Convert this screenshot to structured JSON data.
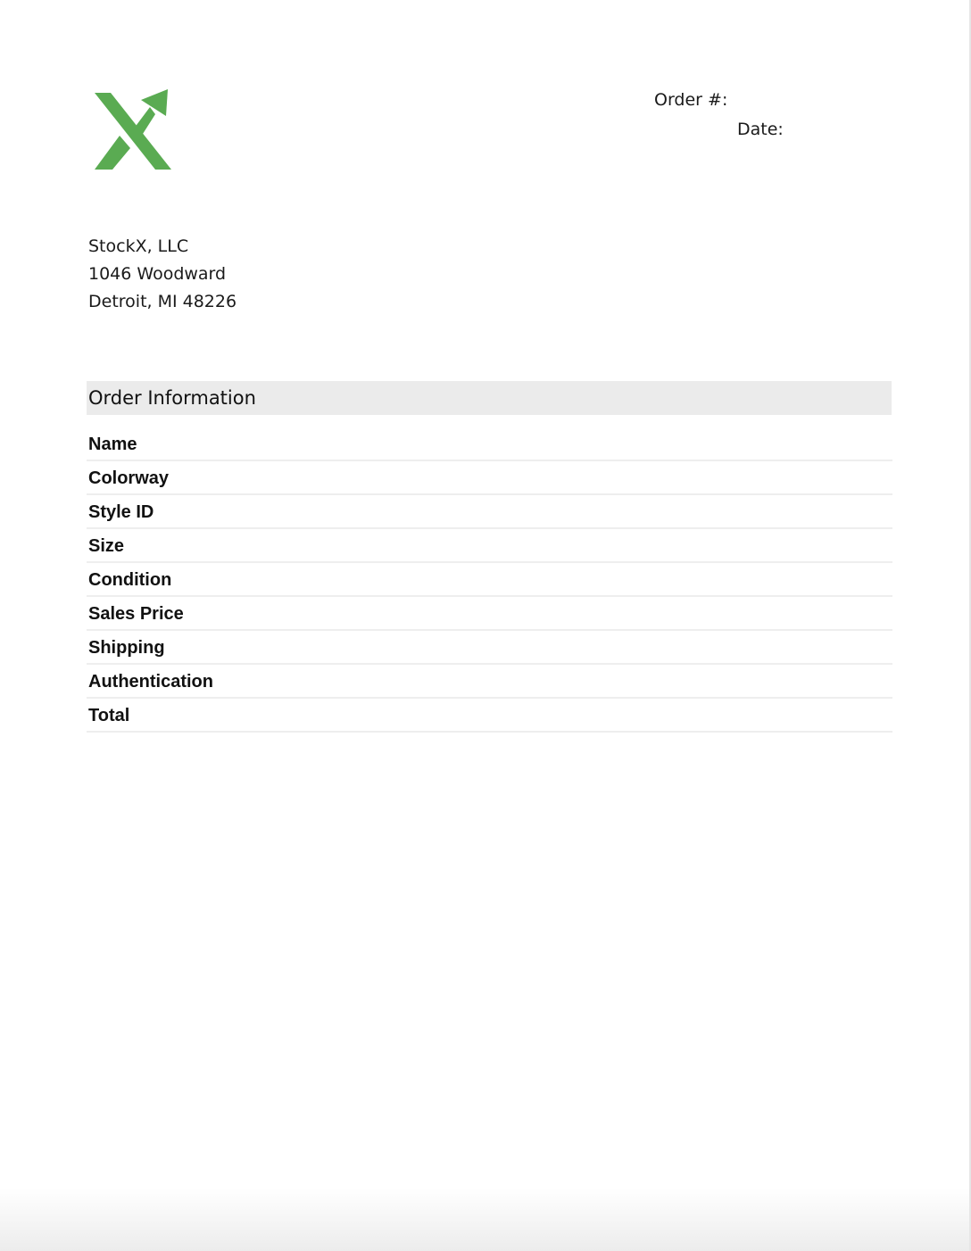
{
  "brand": {
    "logo_icon": "stockx-x-arrow-logo",
    "logo_color": "#5aab52"
  },
  "order_meta": {
    "order_number_label": "Order #:",
    "date_label": "Date:"
  },
  "address": {
    "company": "StockX, LLC",
    "street": "1046 Woodward",
    "city_state_zip": "Detroit, MI 48226"
  },
  "order_information": {
    "title": "Order Information",
    "rows": [
      {
        "label": "Name"
      },
      {
        "label": "Colorway"
      },
      {
        "label": "Style ID"
      },
      {
        "label": "Size"
      },
      {
        "label": "Condition"
      },
      {
        "label": "Sales Price"
      },
      {
        "label": "Shipping"
      },
      {
        "label": "Authentication"
      },
      {
        "label": "Total"
      }
    ]
  }
}
